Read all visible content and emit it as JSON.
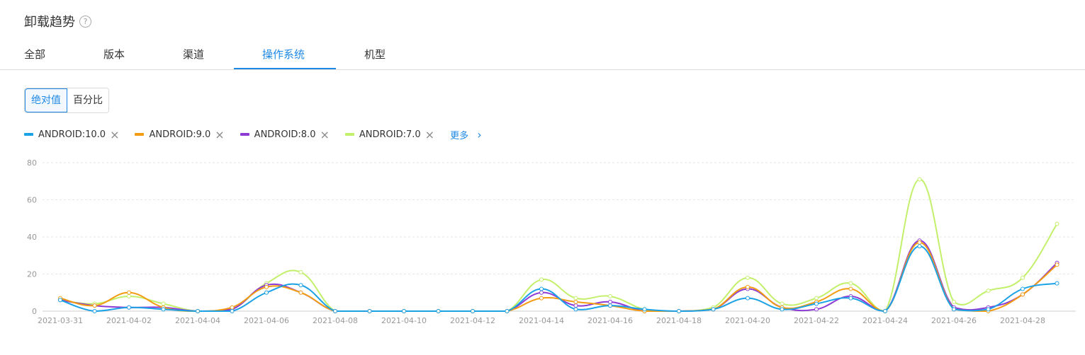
{
  "header": {
    "title": "卸载趋势",
    "help_icon": "?"
  },
  "tabs": [
    {
      "label": "全部"
    },
    {
      "label": "版本"
    },
    {
      "label": "渠道"
    },
    {
      "label": "操作系统",
      "active": true
    },
    {
      "label": "机型"
    }
  ],
  "toggle": {
    "absolute": "绝对值",
    "percent": "百分比",
    "selected": "绝对值"
  },
  "legend": {
    "items": [
      {
        "label": "ANDROID:10.0",
        "color": "#1aa1e6"
      },
      {
        "label": "ANDROID:9.0",
        "color": "#f39c12"
      },
      {
        "label": "ANDROID:8.0",
        "color": "#8e3bd4"
      },
      {
        "label": "ANDROID:7.0",
        "color": "#c3f06a"
      }
    ],
    "close_icon": "×",
    "more_label": "更多",
    "more_icon": "›"
  },
  "chart_data": {
    "type": "line",
    "ylim": [
      0,
      80
    ],
    "yticks": [
      0,
      20,
      40,
      60,
      80
    ],
    "x": [
      "2021-03-31",
      "2021-04-01",
      "2021-04-02",
      "2021-04-03",
      "2021-04-04",
      "2021-04-05",
      "2021-04-06",
      "2021-04-07",
      "2021-04-08",
      "2021-04-09",
      "2021-04-10",
      "2021-04-11",
      "2021-04-12",
      "2021-04-13",
      "2021-04-14",
      "2021-04-15",
      "2021-04-16",
      "2021-04-17",
      "2021-04-18",
      "2021-04-19",
      "2021-04-20",
      "2021-04-21",
      "2021-04-22",
      "2021-04-23",
      "2021-04-24",
      "2021-04-25",
      "2021-04-26",
      "2021-04-27",
      "2021-04-28",
      "2021-04-29"
    ],
    "xtick_labels": [
      "2021-03-31",
      "2021-04-02",
      "2021-04-04",
      "2021-04-06",
      "2021-04-08",
      "2021-04-10",
      "2021-04-12",
      "2021-04-14",
      "2021-04-16",
      "2021-04-18",
      "2021-04-20",
      "2021-04-22",
      "2021-04-24",
      "2021-04-26",
      "2021-04-28"
    ],
    "grid": true,
    "series": [
      {
        "name": "ANDROID:10.0",
        "values": [
          6,
          0,
          2,
          1,
          0,
          0,
          10,
          14,
          0,
          0,
          0,
          0,
          0,
          0,
          12,
          1,
          3,
          1,
          0,
          1,
          7,
          1,
          4,
          7,
          0,
          35,
          1,
          1,
          12,
          15
        ]
      },
      {
        "name": "ANDROID:9.0",
        "values": [
          7,
          3,
          10,
          2,
          0,
          2,
          13,
          10,
          0,
          0,
          0,
          0,
          0,
          0,
          7,
          5,
          3,
          0,
          0,
          1,
          13,
          2,
          5,
          12,
          0,
          37,
          1,
          0,
          9,
          25
        ]
      },
      {
        "name": "ANDROID:8.0",
        "values": [
          6,
          3,
          2,
          2,
          0,
          1,
          14,
          10,
          0,
          0,
          0,
          0,
          0,
          0,
          10,
          3,
          5,
          0,
          0,
          1,
          12,
          2,
          1,
          8,
          0,
          38,
          2,
          2,
          9,
          26
        ]
      },
      {
        "name": "ANDROID:7.0",
        "values": [
          6,
          4,
          8,
          4,
          0,
          1,
          15,
          21,
          0,
          0,
          0,
          0,
          0,
          0,
          17,
          7,
          8,
          1,
          0,
          2,
          18,
          4,
          7,
          15,
          0,
          71,
          5,
          11,
          18,
          47
        ]
      }
    ]
  }
}
